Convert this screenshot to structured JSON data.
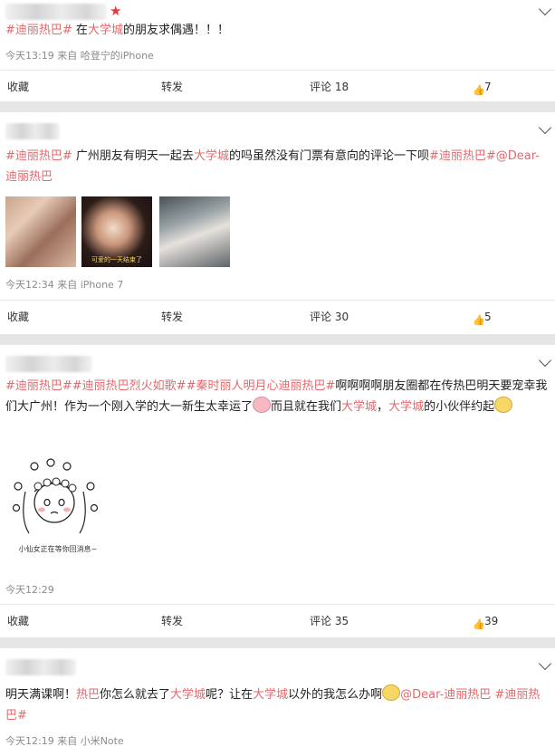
{
  "posts": [
    {
      "text_parts": [
        [
          "tag",
          "#迪丽热巴#"
        ],
        [
          "plain",
          " 在"
        ],
        [
          "tag",
          "大学城"
        ],
        [
          "plain",
          "的朋友求偶遇！！！"
        ]
      ],
      "meta": "今天13:19 来自 哈登宁的iPhone",
      "actions": {
        "favorite": "收藏",
        "repost": "转发",
        "comment": "评论 18",
        "like": "7"
      }
    },
    {
      "text_parts": [
        [
          "tag",
          "#迪丽热巴#"
        ],
        [
          "plain",
          " 广州朋友有明天一起去"
        ],
        [
          "tag",
          "大学城"
        ],
        [
          "plain",
          "的吗虽然没有门票有意向的评论一下呗"
        ],
        [
          "tag",
          "#迪丽热巴#"
        ],
        [
          "tag",
          "@Dear-迪丽热巴"
        ]
      ],
      "photo_caption": "可爱的一天结束了",
      "meta": "今天12:34 来自 iPhone 7",
      "actions": {
        "favorite": "收藏",
        "repost": "转发",
        "comment": "评论 30",
        "like": "5"
      }
    },
    {
      "text_parts": [
        [
          "tag",
          "#迪丽热巴##迪丽热巴烈火如歌##秦时丽人明月心迪丽热巴#"
        ],
        [
          "plain",
          "啊啊啊啊朋友圈都在传热巴明天要宠幸我们大广州！作为一个刚入学的大一新生太幸运了"
        ],
        [
          "emoji",
          "pig"
        ],
        [
          "plain",
          "而且就在我们"
        ],
        [
          "tag",
          "大学城"
        ],
        [
          "plain",
          "，"
        ],
        [
          "tag",
          "大学城"
        ],
        [
          "plain",
          "的小伙伴约起"
        ],
        [
          "emoji",
          "sad"
        ]
      ],
      "sticker_caption": "小仙女正在等你回消息~",
      "meta": "今天12:29",
      "actions": {
        "favorite": "收藏",
        "repost": "转发",
        "comment": "评论 35",
        "like": "39"
      }
    },
    {
      "text_parts": [
        [
          "plain",
          "明天满课啊！"
        ],
        [
          "tag",
          "热巴"
        ],
        [
          "plain",
          "你怎么就去了"
        ],
        [
          "tag",
          "大学城"
        ],
        [
          "plain",
          "呢？让在"
        ],
        [
          "tag",
          "大学城"
        ],
        [
          "plain",
          "以外的我怎么办啊"
        ],
        [
          "emoji",
          "sad"
        ],
        [
          "tag",
          "@Dear-迪丽热巴"
        ],
        [
          "plain",
          " "
        ],
        [
          "tag",
          "#迪丽热巴#"
        ]
      ],
      "meta": "今天12:19 来自 小米Note"
    }
  ]
}
